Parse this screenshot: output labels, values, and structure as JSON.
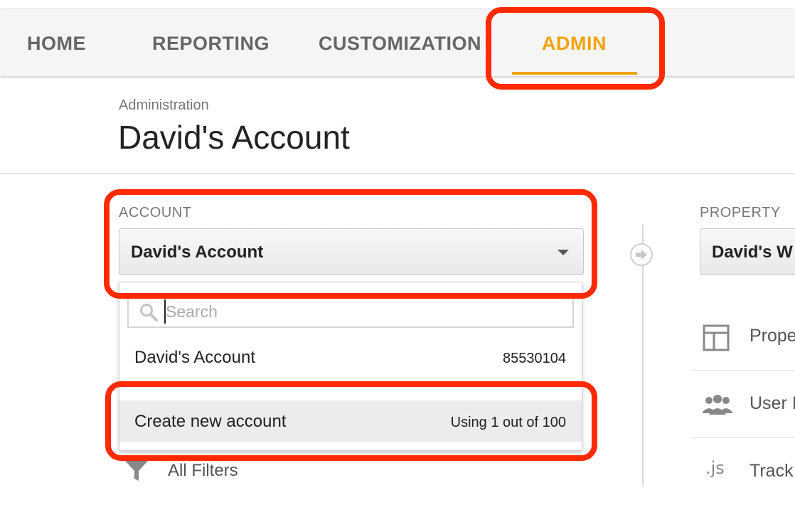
{
  "nav": {
    "tabs": [
      {
        "label": "HOME"
      },
      {
        "label": "REPORTING"
      },
      {
        "label": "CUSTOMIZATION"
      },
      {
        "label": "ADMIN"
      }
    ],
    "active_color": "#f0a30a"
  },
  "header": {
    "breadcrumb": "Administration",
    "title": "David's Account"
  },
  "account": {
    "section_label": "ACCOUNT",
    "selected": "David's Account",
    "dropdown": {
      "search_placeholder": "Search",
      "items": [
        {
          "name": "David's Account",
          "id": "85530104"
        }
      ],
      "create": {
        "label": "Create new account",
        "usage": "Using 1 out of 100"
      }
    },
    "filters_label": "All Filters"
  },
  "property": {
    "section_label": "PROPERTY",
    "selected": "David's W",
    "items": [
      {
        "label": "Prope",
        "icon": "property-settings-icon"
      },
      {
        "label": "User I",
        "icon": "users-icon"
      },
      {
        "label": "Track",
        "icon": "js-icon"
      }
    ]
  },
  "highlight_color": "#ff2a00"
}
